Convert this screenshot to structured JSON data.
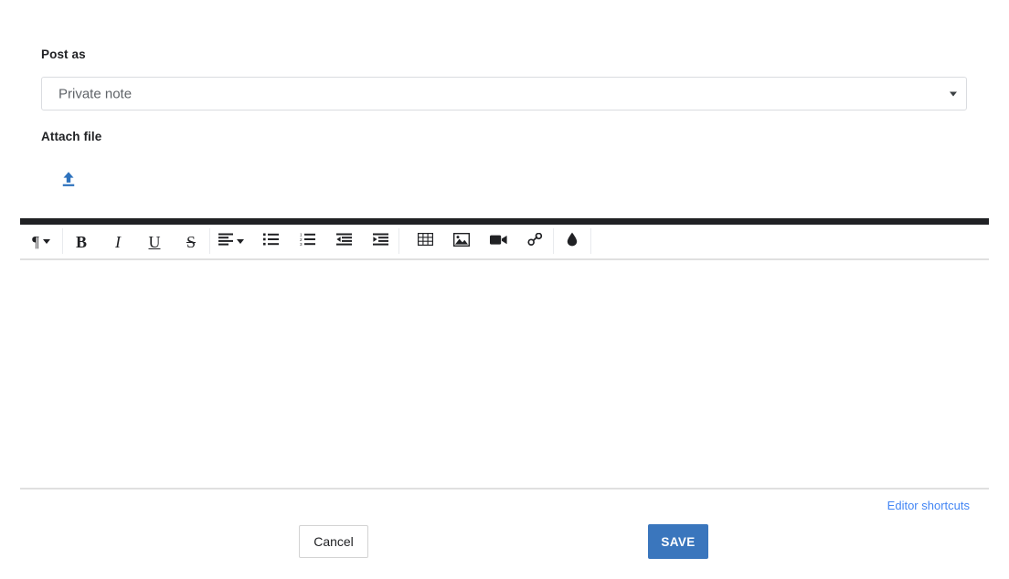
{
  "form": {
    "post_as": {
      "label": "Post as",
      "selected_value": "Private note",
      "caret_icon": "chevron-down-icon"
    },
    "attach_file": {
      "label": "Attach file",
      "upload_icon": "upload-icon"
    }
  },
  "editor": {
    "toolbar": {
      "groups": [
        {
          "items": [
            {
              "name": "paragraph-format-dropdown",
              "glyph": "¶",
              "kind": "dropdown",
              "title": "Paragraph format"
            }
          ]
        },
        {
          "items": [
            {
              "name": "bold-button",
              "glyph": "B",
              "kind": "serif-bold",
              "title": "Bold"
            },
            {
              "name": "italic-button",
              "glyph": "I",
              "kind": "serif-italic",
              "title": "Italic"
            },
            {
              "name": "underline-button",
              "glyph": "U",
              "kind": "serif-underline",
              "title": "Underline"
            },
            {
              "name": "strikethrough-button",
              "glyph": "S",
              "kind": "serif-strike",
              "title": "Strikethrough"
            }
          ]
        },
        {
          "items": [
            {
              "name": "align-dropdown",
              "kind": "icon-align",
              "title": "Alignment"
            },
            {
              "name": "unordered-list-button",
              "kind": "icon-ul",
              "title": "Unordered list"
            },
            {
              "name": "ordered-list-button",
              "kind": "icon-ol",
              "title": "Ordered list"
            },
            {
              "name": "outdent-button",
              "kind": "icon-outdent",
              "title": "Decrease indent"
            },
            {
              "name": "indent-button",
              "kind": "icon-indent",
              "title": "Increase indent"
            }
          ]
        },
        {
          "items": [
            {
              "name": "insert-table-button",
              "kind": "icon-table",
              "title": "Insert table"
            },
            {
              "name": "insert-image-button",
              "kind": "icon-image",
              "title": "Insert image"
            },
            {
              "name": "insert-video-button",
              "kind": "icon-video",
              "title": "Insert video"
            },
            {
              "name": "insert-link-button",
              "kind": "icon-link",
              "title": "Insert link"
            }
          ]
        },
        {
          "items": [
            {
              "name": "text-color-button",
              "kind": "icon-droplet",
              "title": "Colors"
            }
          ]
        }
      ]
    },
    "content": "",
    "content_placeholder": ""
  },
  "footer": {
    "shortcuts_link": "Editor shortcuts",
    "cancel_label": "Cancel",
    "save_label": "SAVE"
  },
  "colors": {
    "accent_blue": "#3a76bd",
    "link_blue": "#4285f4",
    "toolbar_bar": "#202124",
    "border_gray": "#dadce0",
    "muted_text": "#5f6368"
  }
}
